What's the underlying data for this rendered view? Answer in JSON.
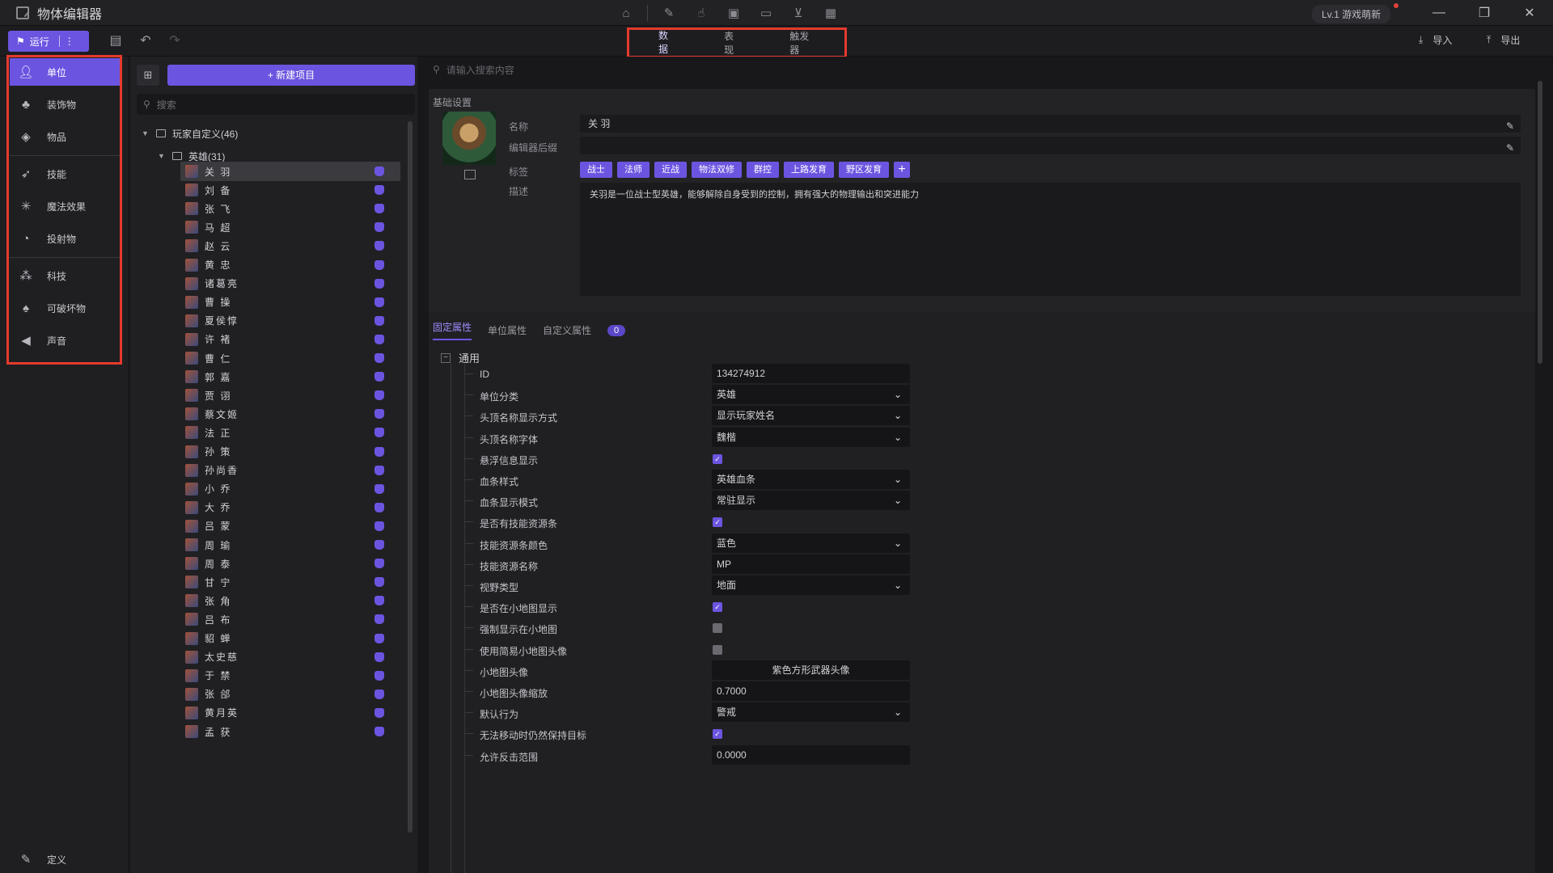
{
  "titlebar": {
    "title": "物体编辑器",
    "level": "Lv.1 游戏萌新",
    "center_icons": [
      "home-icon",
      "edit-icon",
      "hand-icon",
      "save-box-icon",
      "folder-icon",
      "cart-icon",
      "grid-icon"
    ],
    "controls": [
      "minimize-icon",
      "restore-icon",
      "close-icon"
    ]
  },
  "toolbar": {
    "run_label": "运行",
    "tabs": [
      {
        "label": "数据"
      },
      {
        "label": "表现"
      },
      {
        "label": "触发器"
      }
    ],
    "import_label": "导入",
    "export_label": "导出"
  },
  "leftnav": {
    "items": [
      {
        "label": "单位",
        "icon": "person-icon"
      },
      {
        "label": "装饰物",
        "icon": "tree-icon"
      },
      {
        "label": "物品",
        "icon": "box-icon"
      },
      {
        "label": "技能",
        "icon": "skill-icon"
      },
      {
        "label": "魔法效果",
        "icon": "magic-icon"
      },
      {
        "label": "投射物",
        "icon": "projectile-icon"
      },
      {
        "label": "科技",
        "icon": "tech-icon"
      },
      {
        "label": "可破坏物",
        "icon": "destructible-icon"
      },
      {
        "label": "声音",
        "icon": "sound-icon"
      }
    ],
    "bottom_label": "定义"
  },
  "tree": {
    "new_label": "+ 新建项目",
    "search_placeholder": "搜索",
    "root": "玩家自定义(46)",
    "folder": "英雄(31)",
    "heroes": [
      "关 羽",
      "刘 备",
      "张 飞",
      "马 超",
      "赵 云",
      "黄 忠",
      "诸葛亮",
      "曹 操",
      "夏侯惇",
      "许 褚",
      "曹 仁",
      "郭 嘉",
      "贾 诩",
      "蔡文姬",
      "法 正",
      "孙 策",
      "孙尚香",
      "小 乔",
      "大 乔",
      "吕 蒙",
      "周 瑜",
      "周 泰",
      "甘 宁",
      "张 角",
      "吕 布",
      "貂 蝉",
      "太史慈",
      "于 禁",
      "张 郃",
      "黄月英",
      "孟 获"
    ]
  },
  "main": {
    "search_placeholder": "请输入搜索内容",
    "basic_title": "基础设置",
    "name_label": "名称",
    "name_value": "关 羽",
    "suffix_label": "编辑器后缀",
    "suffix_value": "",
    "tags_label": "标签",
    "tags": [
      "战士",
      "法师",
      "近战",
      "物法双修",
      "群控",
      "上路发育",
      "野区发育"
    ],
    "desc_label": "描述",
    "desc_value": "关羽是一位战士型英雄，能够解除自身受到的控制，拥有强大的物理输出和突进能力",
    "subtabs": [
      "固定属性",
      "单位属性",
      "自定义属性"
    ],
    "count": "0",
    "group": "通用",
    "props": [
      {
        "label": "ID",
        "type": "text",
        "value": "134274912"
      },
      {
        "label": "单位分类",
        "type": "select",
        "value": "英雄"
      },
      {
        "label": "头顶名称显示方式",
        "type": "select",
        "value": "显示玩家姓名"
      },
      {
        "label": "头顶名称字体",
        "type": "select",
        "value": "魏楷"
      },
      {
        "label": "悬浮信息显示",
        "type": "check",
        "value": "✓"
      },
      {
        "label": "血条样式",
        "type": "select",
        "value": "英雄血条"
      },
      {
        "label": "血条显示模式",
        "type": "select",
        "value": "常驻显示"
      },
      {
        "label": "是否有技能资源条",
        "type": "check",
        "value": "✓"
      },
      {
        "label": "技能资源条颜色",
        "type": "select",
        "value": "蓝色"
      },
      {
        "label": "技能资源名称",
        "type": "text",
        "value": "MP"
      },
      {
        "label": "视野类型",
        "type": "select",
        "value": "地面"
      },
      {
        "label": "是否在小地图显示",
        "type": "check",
        "value": "✓"
      },
      {
        "label": "强制显示在小地图",
        "type": "checkoff",
        "value": ""
      },
      {
        "label": "使用简易小地图头像",
        "type": "checkoff",
        "value": ""
      },
      {
        "label": "小地图头像",
        "type": "button",
        "value": "紫色方形武器头像"
      },
      {
        "label": "小地图头像缩放",
        "type": "text",
        "value": "0.7000"
      },
      {
        "label": "默认行为",
        "type": "select",
        "value": "警戒"
      },
      {
        "label": "无法移动时仍然保持目标",
        "type": "check",
        "value": "✓"
      },
      {
        "label": "允许反击范围",
        "type": "text",
        "value": "0.0000"
      }
    ]
  },
  "colors": {
    "accent": "#6b55e0",
    "highlight_box": "#e53a2c",
    "bg": "#1a1a1d"
  }
}
